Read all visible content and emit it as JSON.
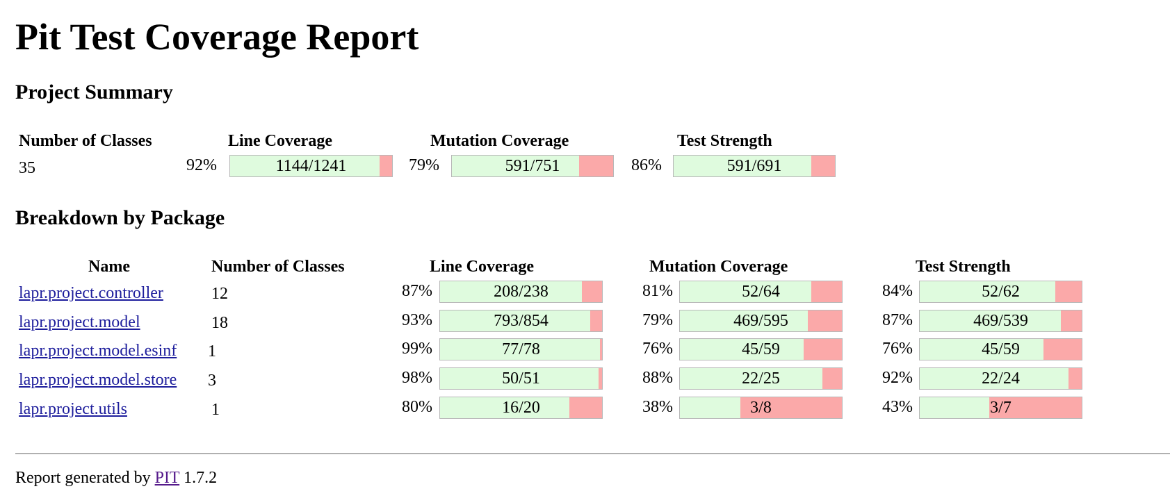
{
  "page": {
    "title": "Pit Test Coverage Report",
    "project_summary_heading": "Project Summary",
    "breakdown_heading": "Breakdown by Package"
  },
  "summary": {
    "headers": {
      "classes": "Number of Classes",
      "line": "Line Coverage",
      "mutation": "Mutation Coverage",
      "strength": "Test Strength"
    },
    "classes": "35",
    "line": {
      "pct": "92%",
      "text": "1144/1241",
      "ratio": 0.9218
    },
    "mutation": {
      "pct": "79%",
      "text": "591/751",
      "ratio": 0.787
    },
    "strength": {
      "pct": "86%",
      "text": "591/691",
      "ratio": 0.8553
    }
  },
  "breakdown": {
    "headers": {
      "name": "Name",
      "classes": "Number of Classes",
      "line": "Line Coverage",
      "mutation": "Mutation Coverage",
      "strength": "Test Strength"
    },
    "rows": [
      {
        "name": "lapr.project.controller",
        "classes": "12",
        "line": {
          "pct": "87%",
          "text": "208/238",
          "ratio": 0.874
        },
        "mutation": {
          "pct": "81%",
          "text": "52/64",
          "ratio": 0.8125
        },
        "strength": {
          "pct": "84%",
          "text": "52/62",
          "ratio": 0.8387
        }
      },
      {
        "name": "lapr.project.model",
        "classes": "18",
        "line": {
          "pct": "93%",
          "text": "793/854",
          "ratio": 0.9286
        },
        "mutation": {
          "pct": "79%",
          "text": "469/595",
          "ratio": 0.7882
        },
        "strength": {
          "pct": "87%",
          "text": "469/539",
          "ratio": 0.8701
        }
      },
      {
        "name": "lapr.project.model.esinf",
        "classes": "1",
        "line": {
          "pct": "99%",
          "text": "77/78",
          "ratio": 0.9872
        },
        "mutation": {
          "pct": "76%",
          "text": "45/59",
          "ratio": 0.7627
        },
        "strength": {
          "pct": "76%",
          "text": "45/59",
          "ratio": 0.7627
        }
      },
      {
        "name": "lapr.project.model.store",
        "classes": "3",
        "line": {
          "pct": "98%",
          "text": "50/51",
          "ratio": 0.9804
        },
        "mutation": {
          "pct": "88%",
          "text": "22/25",
          "ratio": 0.88
        },
        "strength": {
          "pct": "92%",
          "text": "22/24",
          "ratio": 0.9167
        }
      },
      {
        "name": "lapr.project.utils",
        "classes": "1",
        "line": {
          "pct": "80%",
          "text": "16/20",
          "ratio": 0.8
        },
        "mutation": {
          "pct": "38%",
          "text": "3/8",
          "ratio": 0.375
        },
        "strength": {
          "pct": "43%",
          "text": "3/7",
          "ratio": 0.4286
        }
      }
    ]
  },
  "footer": {
    "prefix": "Report generated by",
    "link": "PIT",
    "version": "1.7.2"
  },
  "colors": {
    "covered": "#dffbde",
    "uncovered": "#fba9a9",
    "link": "#1d1d9c",
    "visited_link": "#551a8b"
  }
}
